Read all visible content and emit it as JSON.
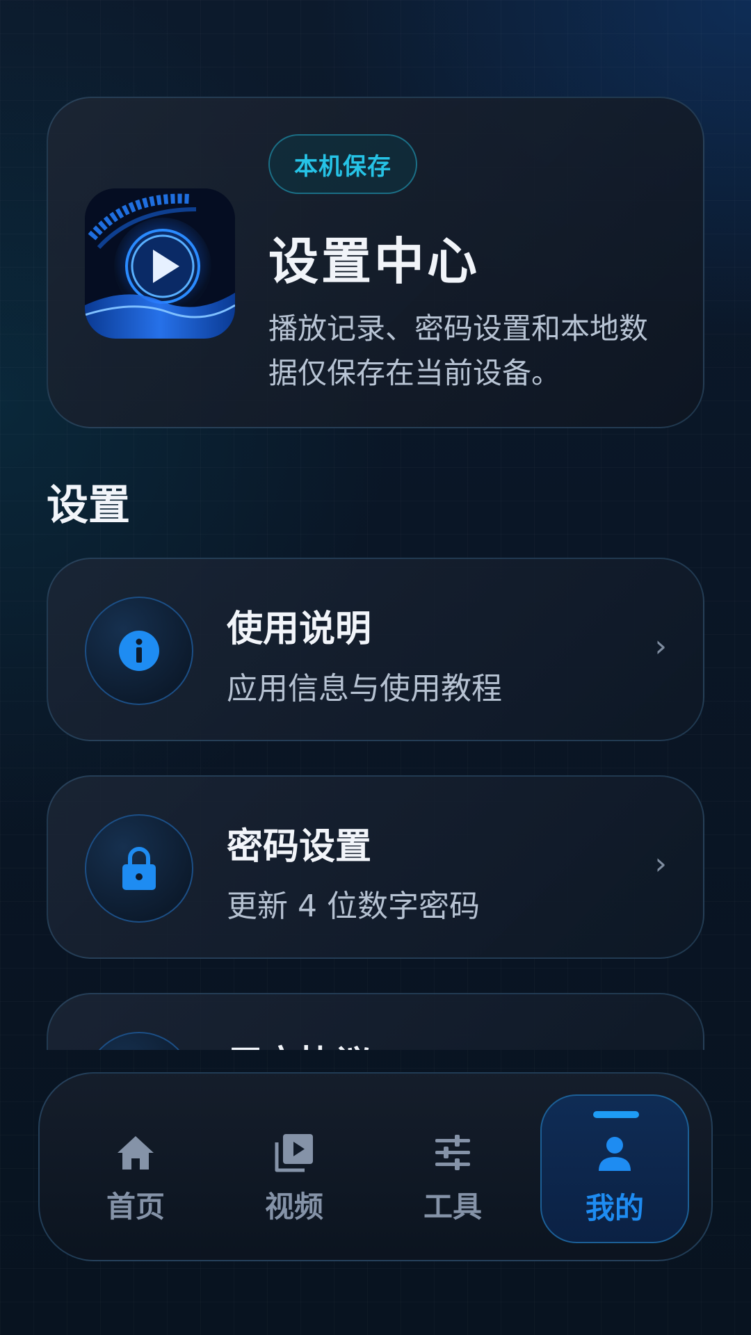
{
  "hero": {
    "badge": "本机保存",
    "title": "设置中心",
    "description": "播放记录、密码设置和本地数据仅保存在当前设备。"
  },
  "section": {
    "title": "设置"
  },
  "settings": [
    {
      "title": "使用说明",
      "subtitle": "应用信息与使用教程",
      "icon": "info-icon"
    },
    {
      "title": "密码设置",
      "subtitle": "更新 4 位数字密码",
      "icon": "lock-icon"
    },
    {
      "title": "用户协议",
      "subtitle": "",
      "icon": "document-icon"
    }
  ],
  "nav": {
    "items": [
      {
        "label": "首页",
        "icon": "home-icon"
      },
      {
        "label": "视频",
        "icon": "video-library-icon"
      },
      {
        "label": "工具",
        "icon": "sliders-icon"
      },
      {
        "label": "我的",
        "icon": "person-icon"
      }
    ],
    "active_index": 3
  },
  "colors": {
    "accent": "#1E8CF2",
    "badge_text": "#26C3E6",
    "muted_nav": "#8593A8"
  }
}
